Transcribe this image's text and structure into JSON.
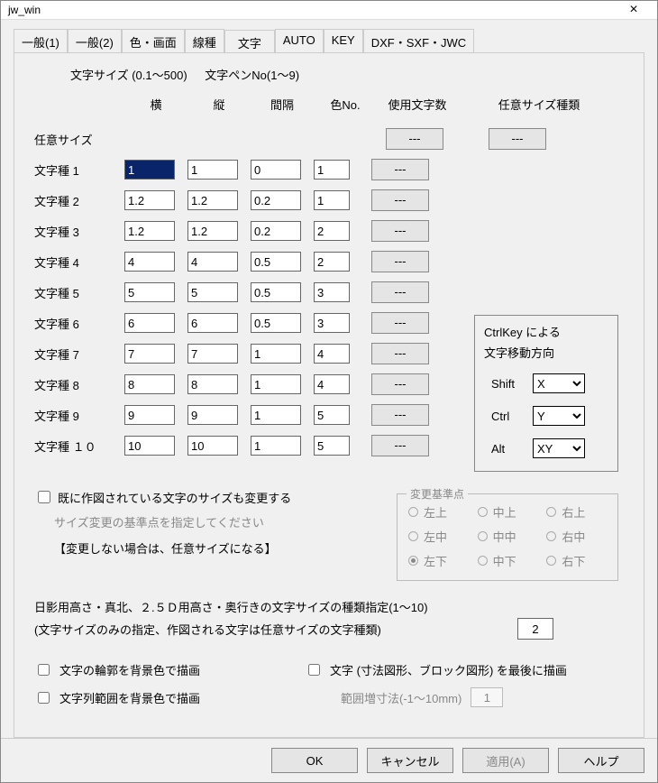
{
  "window": {
    "title": "jw_win"
  },
  "tabs": [
    "一般(1)",
    "一般(2)",
    "色・画面",
    "線種",
    "文字",
    "AUTO",
    "KEY",
    "DXF・SXF・JWC"
  ],
  "active_tab": 4,
  "heading": {
    "size_range": "文字サイズ (0.1～500)",
    "pen_range": "文字ペンNo(1～9)"
  },
  "columns": {
    "h1": "横",
    "h2": "縦",
    "h3": "間隔",
    "h4": "色No.",
    "h5": "使用文字数",
    "h6": "任意サイズ種類"
  },
  "any_size_label": "任意サイズ",
  "placeholder_btn": "---",
  "rows": [
    {
      "label": "文字種 1",
      "w": "1",
      "h": "1",
      "sp": "0",
      "c": "1",
      "selected": true
    },
    {
      "label": "文字種 2",
      "w": "1.2",
      "h": "1.2",
      "sp": "0.2",
      "c": "1"
    },
    {
      "label": "文字種 3",
      "w": "1.2",
      "h": "1.2",
      "sp": "0.2",
      "c": "2"
    },
    {
      "label": "文字種 4",
      "w": "4",
      "h": "4",
      "sp": "0.5",
      "c": "2"
    },
    {
      "label": "文字種 5",
      "w": "5",
      "h": "5",
      "sp": "0.5",
      "c": "3"
    },
    {
      "label": "文字種 6",
      "w": "6",
      "h": "6",
      "sp": "0.5",
      "c": "3"
    },
    {
      "label": "文字種 7",
      "w": "7",
      "h": "7",
      "sp": "1",
      "c": "4"
    },
    {
      "label": "文字種 8",
      "w": "8",
      "h": "8",
      "sp": "1",
      "c": "4"
    },
    {
      "label": "文字種 9",
      "w": "9",
      "h": "9",
      "sp": "1",
      "c": "5"
    },
    {
      "label": "文字種 １０",
      "w": "10",
      "h": "10",
      "sp": "1",
      "c": "5"
    }
  ],
  "ctrlkey": {
    "title1": "CtrlKey による",
    "title2": "文字移動方向",
    "shift_label": "Shift",
    "shift_val": "X",
    "ctrl_label": "Ctrl",
    "ctrl_val": "Y",
    "alt_label": "Alt",
    "alt_val": "XY"
  },
  "resize_check": "既に作図されている文字のサイズも変更する",
  "resize_hint": "サイズ変更の基準点を指定してください",
  "resize_note": "【変更しない場合は、任意サイズになる】",
  "anchor": {
    "title": "変更基準点",
    "items": [
      "左上",
      "中上",
      "右上",
      "左中",
      "中中",
      "右中",
      "左下",
      "中下",
      "右下"
    ],
    "selected": 6
  },
  "desc1": "日影用高さ・真北、２.５Ｄ用高さ・奥行きの文字サイズの種類指定(1～10)",
  "desc2": "(文字サイズのみの指定、作図される文字は任意サイズの文字種類)",
  "desc_val": "2",
  "outline_check": "文字の輪郭を背景色で描画",
  "last_check": "文字 (寸法図形、ブロック図形) を最後に描画",
  "range_check": "文字列範囲を背景色で描画",
  "range_label": "範囲増寸法(-1～10mm)",
  "range_val": "1",
  "footer": {
    "ok": "OK",
    "cancel": "キャンセル",
    "apply": "適用(A)",
    "help": "ヘルプ"
  }
}
